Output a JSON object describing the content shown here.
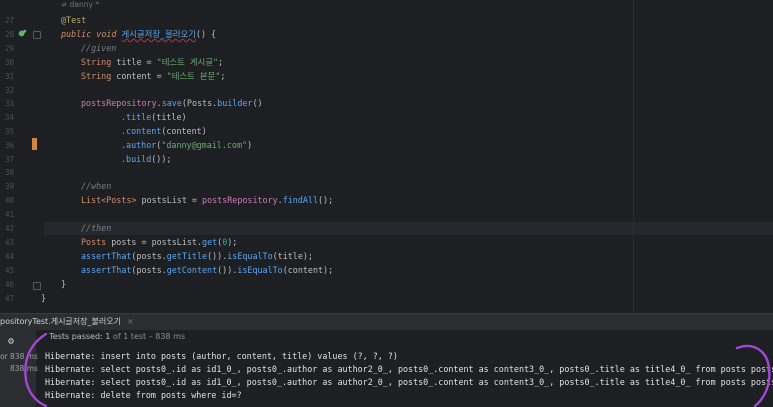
{
  "author_hint": "≠ danny *",
  "line_numbers": [
    "27",
    "28",
    "29",
    "30",
    "31",
    "32",
    "33",
    "34",
    "35",
    "36",
    "37",
    "38",
    "39",
    "40",
    "41",
    "42",
    "43",
    "44",
    "45",
    "46",
    "47"
  ],
  "code": {
    "l27": "@Test",
    "l28_kw": "public void",
    "l28_name": "게시글저장_불러오기",
    "l28_end": "() {",
    "l29": "//given",
    "l30_type": "String",
    "l30_mid": " title = ",
    "l30_str": "\"테스트 게시글\"",
    "l30_end": ";",
    "l31_type": "String",
    "l31_mid": " content = ",
    "l31_str": "\"테스트 본문\"",
    "l31_end": ";",
    "l33_var": "postsRepository",
    "l33_dot": ".",
    "l33_fn": "save",
    "l33_p": "(Posts.",
    "l33_fn2": "builder",
    "l33_end": "()",
    "l34_fn": ".title",
    "l34_end": "(title)",
    "l35_fn": ".content",
    "l35_end": "(content)",
    "l36_fn": ".author",
    "l36_p": "(",
    "l36_str": "\"danny@gmail.com\"",
    "l36_end": ")",
    "l37_fn": ".build",
    "l37_end": "());",
    "l39": "//when",
    "l40_type": "List<Posts>",
    "l40_mid": " postsList = ",
    "l40_var": "postsRepository",
    "l40_dot": ".",
    "l40_fn": "findAll",
    "l40_end": "();",
    "l42": "//then",
    "l43_type": "Posts",
    "l43_mid": " posts = postsList.",
    "l43_fn": "get",
    "l43_p": "(",
    "l43_num": "0",
    "l43_end": ");",
    "l44_fn": "assertThat",
    "l44_a": "(posts.",
    "l44_fn2": "getTitle",
    "l44_b": "()).",
    "l44_fn3": "isEqualTo",
    "l44_end": "(title);",
    "l45_fn": "assertThat",
    "l45_a": "(posts.",
    "l45_fn2": "getContent",
    "l45_b": "()).",
    "l45_fn3": "isEqualTo",
    "l45_end": "(content);",
    "l46": "}",
    "l47": "}"
  },
  "tab": {
    "label": "positoryTest.게시글저장_불러오기",
    "close": "×"
  },
  "run": {
    "times": [
      "or 838 ms",
      "838 ms"
    ],
    "status_prefix": "Tests passed: ",
    "status_count": "1",
    "status_suffix": " of 1 test – 838 ms",
    "output": [
      "Hibernate: insert into posts (author, content, title) values (?, ?, ?)",
      "Hibernate: select posts0_.id as id1_0_, posts0_.author as author2_0_, posts0_.content as content3_0_, posts0_.title as title4_0_ from posts posts0_",
      "Hibernate: select posts0_.id as id1_0_, posts0_.author as author2_0_, posts0_.content as content3_0_, posts0_.title as title4_0_ from posts posts0_",
      "Hibernate: delete from posts where id=?"
    ]
  },
  "colors": {
    "keyword": "#cf8e6d",
    "string": "#6aab73",
    "function": "#56a8f5",
    "field": "#c77dbb",
    "annotation": "#b3ae60",
    "pen": "#a347d6",
    "pass": "#5fb865"
  }
}
